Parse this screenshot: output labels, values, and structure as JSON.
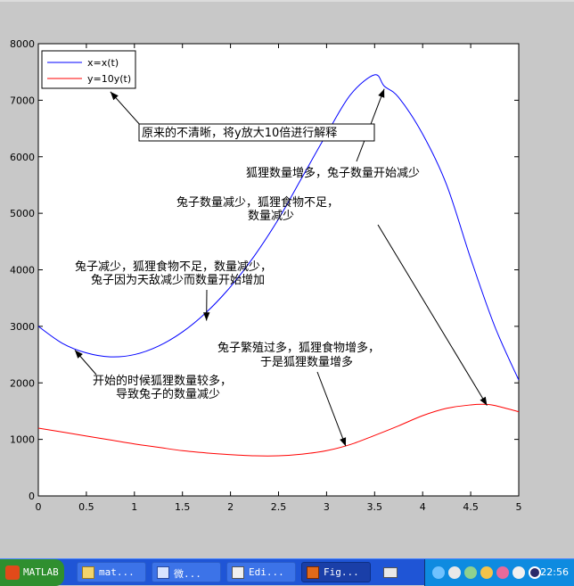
{
  "chart_data": {
    "type": "line",
    "x_ticks": [
      "0",
      "0.5",
      "1",
      "1.5",
      "2",
      "2.5",
      "3",
      "3.5",
      "4",
      "4.5",
      "5"
    ],
    "y_ticks": [
      "0",
      "1000",
      "2000",
      "3000",
      "4000",
      "5000",
      "6000",
      "7000",
      "8000"
    ],
    "xlim": [
      0,
      5
    ],
    "ylim": [
      0,
      8000
    ],
    "grid": false,
    "legend_position": "top-left",
    "series": [
      {
        "name": "x=x(t)",
        "color": "#0000ff",
        "x": [
          0,
          0.25,
          0.5,
          0.75,
          1.0,
          1.25,
          1.5,
          1.75,
          2.0,
          2.25,
          2.5,
          2.75,
          3.0,
          3.25,
          3.5,
          3.6,
          3.75,
          4.0,
          4.25,
          4.5,
          4.75,
          5.0
        ],
        "y": [
          3000,
          2700,
          2530,
          2460,
          2500,
          2650,
          2900,
          3250,
          3700,
          4250,
          4900,
          5650,
          6400,
          7100,
          7450,
          7250,
          7050,
          6400,
          5500,
          4200,
          3000,
          2050
        ]
      },
      {
        "name": "y=10y(t)",
        "color": "#ff0000",
        "x": [
          0,
          0.25,
          0.5,
          0.75,
          1.0,
          1.25,
          1.5,
          1.75,
          2.0,
          2.25,
          2.5,
          2.75,
          3.0,
          3.25,
          3.5,
          3.75,
          4.0,
          4.25,
          4.5,
          4.65,
          4.75,
          5.0
        ],
        "y": [
          1200,
          1130,
          1060,
          990,
          920,
          860,
          800,
          760,
          730,
          710,
          710,
          740,
          800,
          910,
          1070,
          1240,
          1420,
          1550,
          1610,
          1620,
          1600,
          1490
        ]
      }
    ],
    "annotations": [
      {
        "text": "原来的不清晰，将y放大10倍进行解释",
        "boxed": true,
        "arrow_to": [
          0.75,
          7150
        ]
      },
      {
        "text": "狐狸数量增多，兔子数量开始减少",
        "arrow_to": [
          3.6,
          7200
        ]
      },
      {
        "text": "兔子数量减少，狐狸食物不足，",
        "arrow_to": [
          4.67,
          1600
        ]
      },
      {
        "text": "数量减少"
      },
      {
        "text": "兔子减少，狐狸食物不足，数量减少，",
        "arrow_to": [
          1.75,
          3100
        ]
      },
      {
        "text": "兔子因为天敌减少而数量开始增加"
      },
      {
        "text": "兔子繁殖过多，狐狸食物增多，",
        "arrow_to": [
          3.2,
          880
        ]
      },
      {
        "text": "于是狐狸数量增多"
      },
      {
        "text": "开始的时候狐狸数量较多，",
        "arrow_to": [
          0.38,
          2580
        ]
      },
      {
        "text": "导致兔子的数量减少"
      }
    ]
  },
  "taskbar": {
    "start_label": "MATLAB",
    "buttons": [
      {
        "label": "mat..."
      },
      {
        "label": "微..."
      },
      {
        "label": "Edi..."
      },
      {
        "label": "Fig..."
      }
    ],
    "clock": "22:56"
  }
}
